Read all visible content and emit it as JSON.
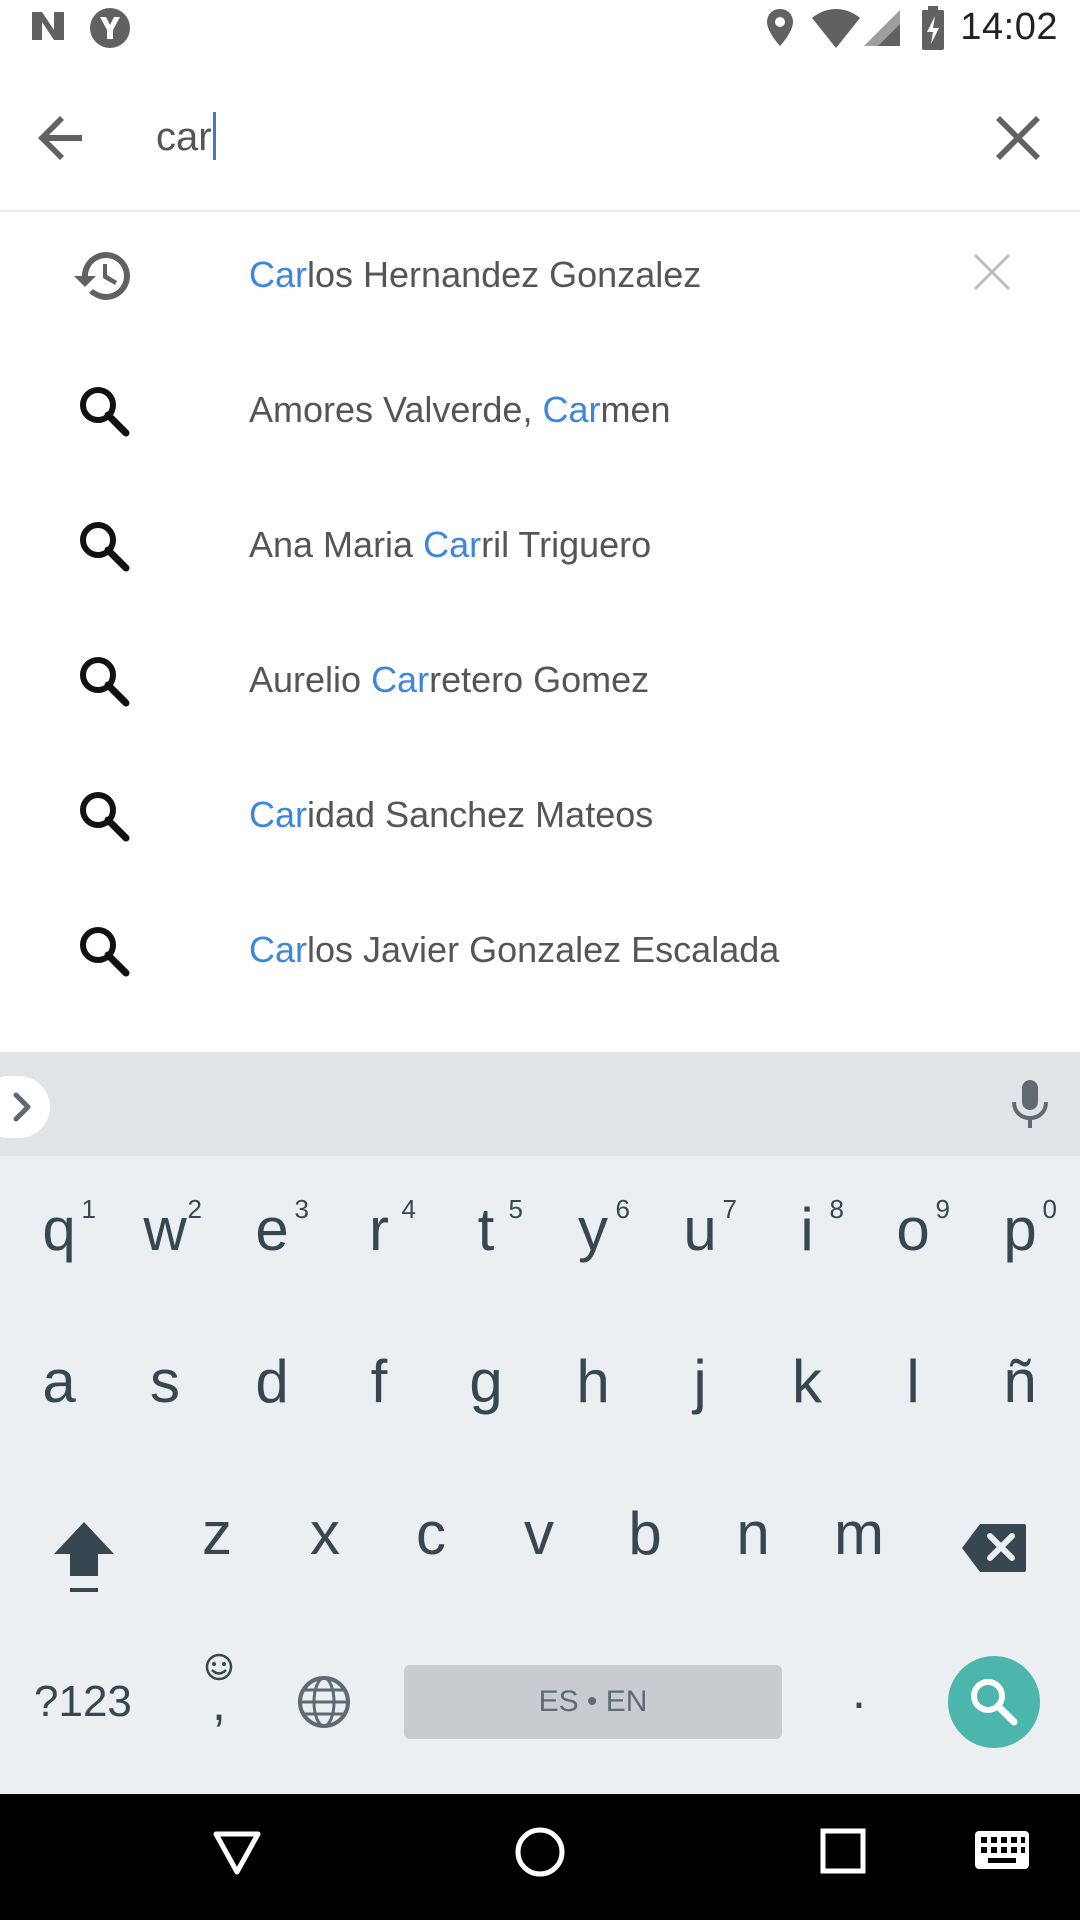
{
  "status": {
    "time": "14:02"
  },
  "search": {
    "query": "car"
  },
  "suggestions": [
    {
      "type": "history",
      "highlight": "Car",
      "rest": "los Hernandez Gonzalez"
    },
    {
      "type": "search",
      "prefix": "Amores Valverde, ",
      "highlight": "Car",
      "rest": "men"
    },
    {
      "type": "search",
      "prefix": "Ana Maria ",
      "highlight": "Car",
      "rest": "ril Triguero"
    },
    {
      "type": "search",
      "prefix": "Aurelio ",
      "highlight": "Car",
      "rest": "retero Gomez"
    },
    {
      "type": "search",
      "highlight": "Car",
      "rest": "idad Sanchez Mateos"
    },
    {
      "type": "search",
      "highlight": "Car",
      "rest": "los Javier Gonzalez Escalada"
    }
  ],
  "keyboard": {
    "row1": [
      "q",
      "w",
      "e",
      "r",
      "t",
      "y",
      "u",
      "i",
      "o",
      "p"
    ],
    "row1_nums": [
      "1",
      "2",
      "3",
      "4",
      "5",
      "6",
      "7",
      "8",
      "9",
      "0"
    ],
    "row2": [
      "a",
      "s",
      "d",
      "f",
      "g",
      "h",
      "j",
      "k",
      "l",
      "ñ"
    ],
    "row3": [
      "z",
      "x",
      "c",
      "v",
      "b",
      "n",
      "m"
    ],
    "symbols_label": "?123",
    "comma": ",",
    "period": ".",
    "space_label": "ES • EN"
  },
  "colors": {
    "highlight": "#3d86e0",
    "search_key": "#4db6ac"
  },
  "icons": {
    "status_left": [
      "n-icon",
      "y-notification-icon"
    ],
    "status_right": [
      "location-icon",
      "wifi-icon",
      "signal-icon",
      "battery-charging-icon"
    ],
    "nav": [
      "back-triangle-icon",
      "home-circle-icon",
      "recents-square-icon",
      "keyboard-icon"
    ]
  }
}
